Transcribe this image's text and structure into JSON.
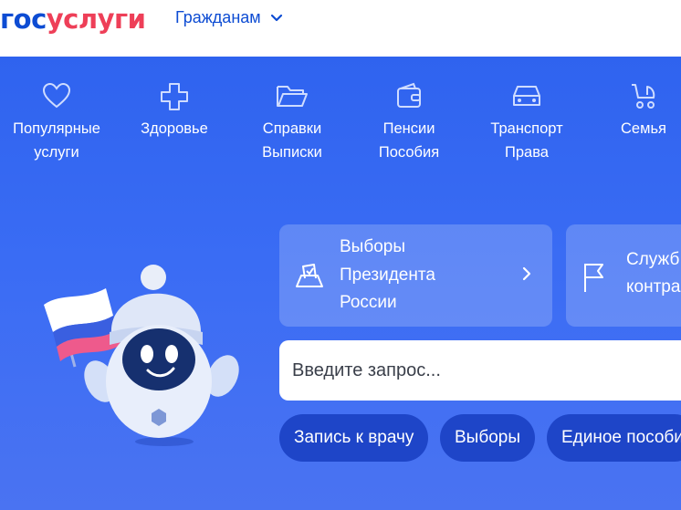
{
  "header": {
    "logo_part1": "гос",
    "logo_part2": "услуги",
    "audience_label": "Гражданам"
  },
  "categories": [
    {
      "label": "Популярные\nуслуги",
      "icon": "heart-icon"
    },
    {
      "label": "Здоровье",
      "icon": "medical-cross-icon"
    },
    {
      "label": "Справки\nВыписки",
      "icon": "folder-icon"
    },
    {
      "label": "Пенсии\nПособия",
      "icon": "wallet-icon"
    },
    {
      "label": "Транспорт\nПрава",
      "icon": "car-icon"
    },
    {
      "label": "Семья",
      "icon": "stroller-icon"
    }
  ],
  "cards": [
    {
      "label": "Выборы\nПрезидента\nРоссии",
      "icon": "ballot-box-icon"
    },
    {
      "label": "Служб\nконтра",
      "icon": "flag-icon"
    }
  ],
  "search": {
    "placeholder": "Введите запрос..."
  },
  "chips": [
    {
      "label": "Запись к врачу"
    },
    {
      "label": "Выборы"
    },
    {
      "label": "Единое пособи"
    }
  ],
  "colors": {
    "brand_blue": "#0d4cd3",
    "brand_red": "#ee3f58",
    "hero_blue": "#3a6cf4",
    "chip_blue": "#1e45c8"
  }
}
